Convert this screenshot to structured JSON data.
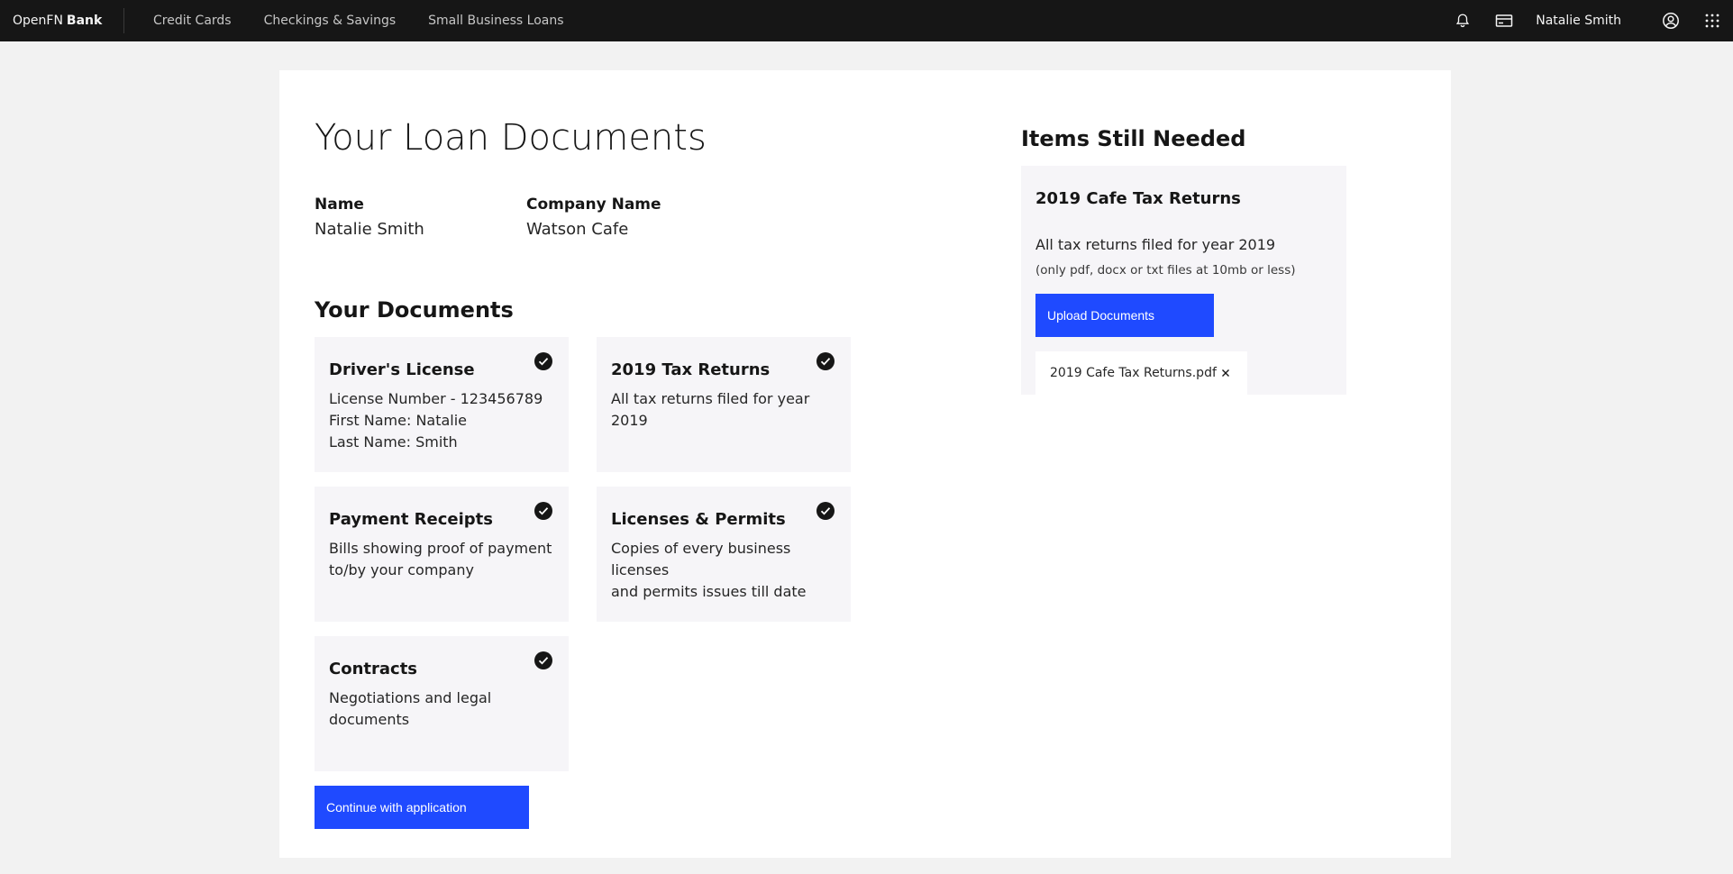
{
  "topnav": {
    "brand_prefix": "OpenFN",
    "brand_bold": "Bank",
    "links": [
      "Credit Cards",
      "Checkings & Savings",
      "Small Business Loans"
    ],
    "user_name": "Natalie Smith",
    "icons": [
      "bell-icon",
      "credit-card-icon",
      "user-avatar-icon",
      "app-grid-icon"
    ]
  },
  "page": {
    "title": "Your Loan Documents",
    "name_label": "Name",
    "name_value": "Natalie Smith",
    "company_label": "Company Name",
    "company_value": "Watson Cafe",
    "documents_title": "Your Documents",
    "continue_label": "Continue with application"
  },
  "documents": [
    {
      "title": "Driver's License",
      "lines": [
        "License Number - 123456789",
        "First Name: Natalie",
        "Last Name: Smith"
      ]
    },
    {
      "title": "2019 Tax Returns",
      "lines": [
        "All tax returns filed for year 2019"
      ]
    },
    {
      "title": "Payment Receipts",
      "lines": [
        "Bills showing proof of payment",
        "to/by your company"
      ]
    },
    {
      "title": "Licenses & Permits",
      "lines": [
        "Copies of every business licenses",
        "and permits issues till date"
      ]
    },
    {
      "title": "Contracts",
      "lines": [
        "Negotiations and legal documents"
      ]
    }
  ],
  "needed": {
    "title": "Items Still Needed",
    "item_title": "2019 Cafe Tax Returns",
    "item_desc": "All tax returns filed for year 2019",
    "item_note": "(only pdf, docx or txt files at 10mb or less)",
    "upload_label": "Upload Documents",
    "file_name": "2019 Cafe Tax Returns.pdf"
  },
  "colors": {
    "primary": "#1f4aff",
    "nav_bg": "#161616",
    "card_bg": "#f6f5f8",
    "page_bg": "#f2f2f2"
  }
}
